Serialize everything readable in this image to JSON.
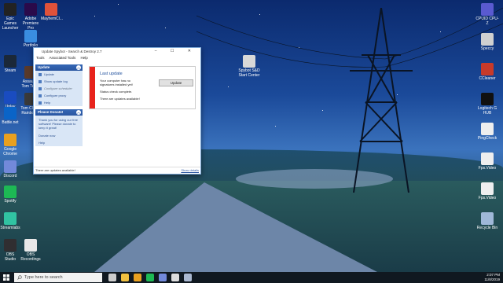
{
  "desktop": {
    "icons_left": [
      {
        "label": "Epic Games Launcher",
        "color": "#222222"
      },
      {
        "label": "Adobe Premiere Pro",
        "color": "#2a0a4a"
      },
      {
        "label": "MayhemCl...",
        "color": "#e0523a"
      },
      {
        "label": "Portfolio",
        "color": "#3a8de0"
      },
      {
        "label": "Steam",
        "color": "#1b2838"
      },
      {
        "label": "Assault... Tom Tee...",
        "color": "#5a3a2a"
      },
      {
        "label": "Uplay",
        "color": "#1a4cc0"
      },
      {
        "label": "Tom Clan... Rainbow...",
        "color": "#3a3a3a"
      },
      {
        "label": "Battle.net",
        "color": "#0a64c8"
      },
      {
        "label": "Google Chrome",
        "color": "#e8a020"
      },
      {
        "label": "Discord",
        "color": "#7289da"
      },
      {
        "label": "Spotify",
        "color": "#1db954"
      },
      {
        "label": "Streamlabs",
        "color": "#31c3a2"
      },
      {
        "label": "OBS Studio",
        "color": "#302e31"
      },
      {
        "label": "OBS Recordings",
        "color": "#e8e8e8"
      }
    ],
    "icons_right": [
      {
        "label": "CPUID CPU-Z",
        "color": "#5a5ad0"
      },
      {
        "label": "Speccy",
        "color": "#d0d0d0"
      },
      {
        "label": "CCleaner",
        "color": "#c83a2a"
      },
      {
        "label": "Logitech G HUB",
        "color": "#101010"
      },
      {
        "label": "PingCheck",
        "color": "#eeeeee"
      },
      {
        "label": "Fps.Video",
        "color": "#eeeeee"
      },
      {
        "label": "Fps.Video",
        "color": "#eeeeee"
      },
      {
        "label": "Recycle Bin",
        "color": "#9fb8d8"
      }
    ],
    "center_icon": {
      "label": "Spybot S&D Start Center",
      "color": "#d8d8d8"
    }
  },
  "window": {
    "title": "Update Spybot - Search & Destroy 2.7",
    "controls": "– ☐ ✕",
    "menu": [
      "Tools",
      "Associated Tools",
      "Help"
    ],
    "update_panel": {
      "header": "Update",
      "items": [
        {
          "label": "Update",
          "dim": false
        },
        {
          "label": "Show update log",
          "dim": false
        },
        {
          "label": "Configure scheduler",
          "dim": true
        },
        {
          "label": "Configure proxy",
          "dim": false
        },
        {
          "label": "Help",
          "dim": false
        }
      ]
    },
    "donate_panel": {
      "header": "Please Donate!",
      "text": "Thank you for using our free software! Please donate to keep it great!",
      "donate_link": "Donate now",
      "help_link": "Help"
    },
    "content": {
      "title": "Last update",
      "line1": "Your computer has no",
      "line2": "signatures installed yet!",
      "status": "Status check complete.",
      "message": "There are updates available!",
      "button_label": "Update"
    },
    "status_left": "There are updates available!",
    "status_right": "Show details"
  },
  "taskbar": {
    "search_placeholder": "Type here to search",
    "time": "2:07 PM",
    "date": "11/8/2019",
    "apps": [
      {
        "name": "task-view",
        "color": "#cccccc"
      },
      {
        "name": "file-explorer",
        "color": "#f0c040"
      },
      {
        "name": "chrome",
        "color": "#e8a020"
      },
      {
        "name": "spotify",
        "color": "#1db954"
      },
      {
        "name": "discord",
        "color": "#7289da"
      },
      {
        "name": "obs",
        "color": "#dddddd"
      },
      {
        "name": "spybot",
        "color": "#aab8d0"
      }
    ]
  }
}
